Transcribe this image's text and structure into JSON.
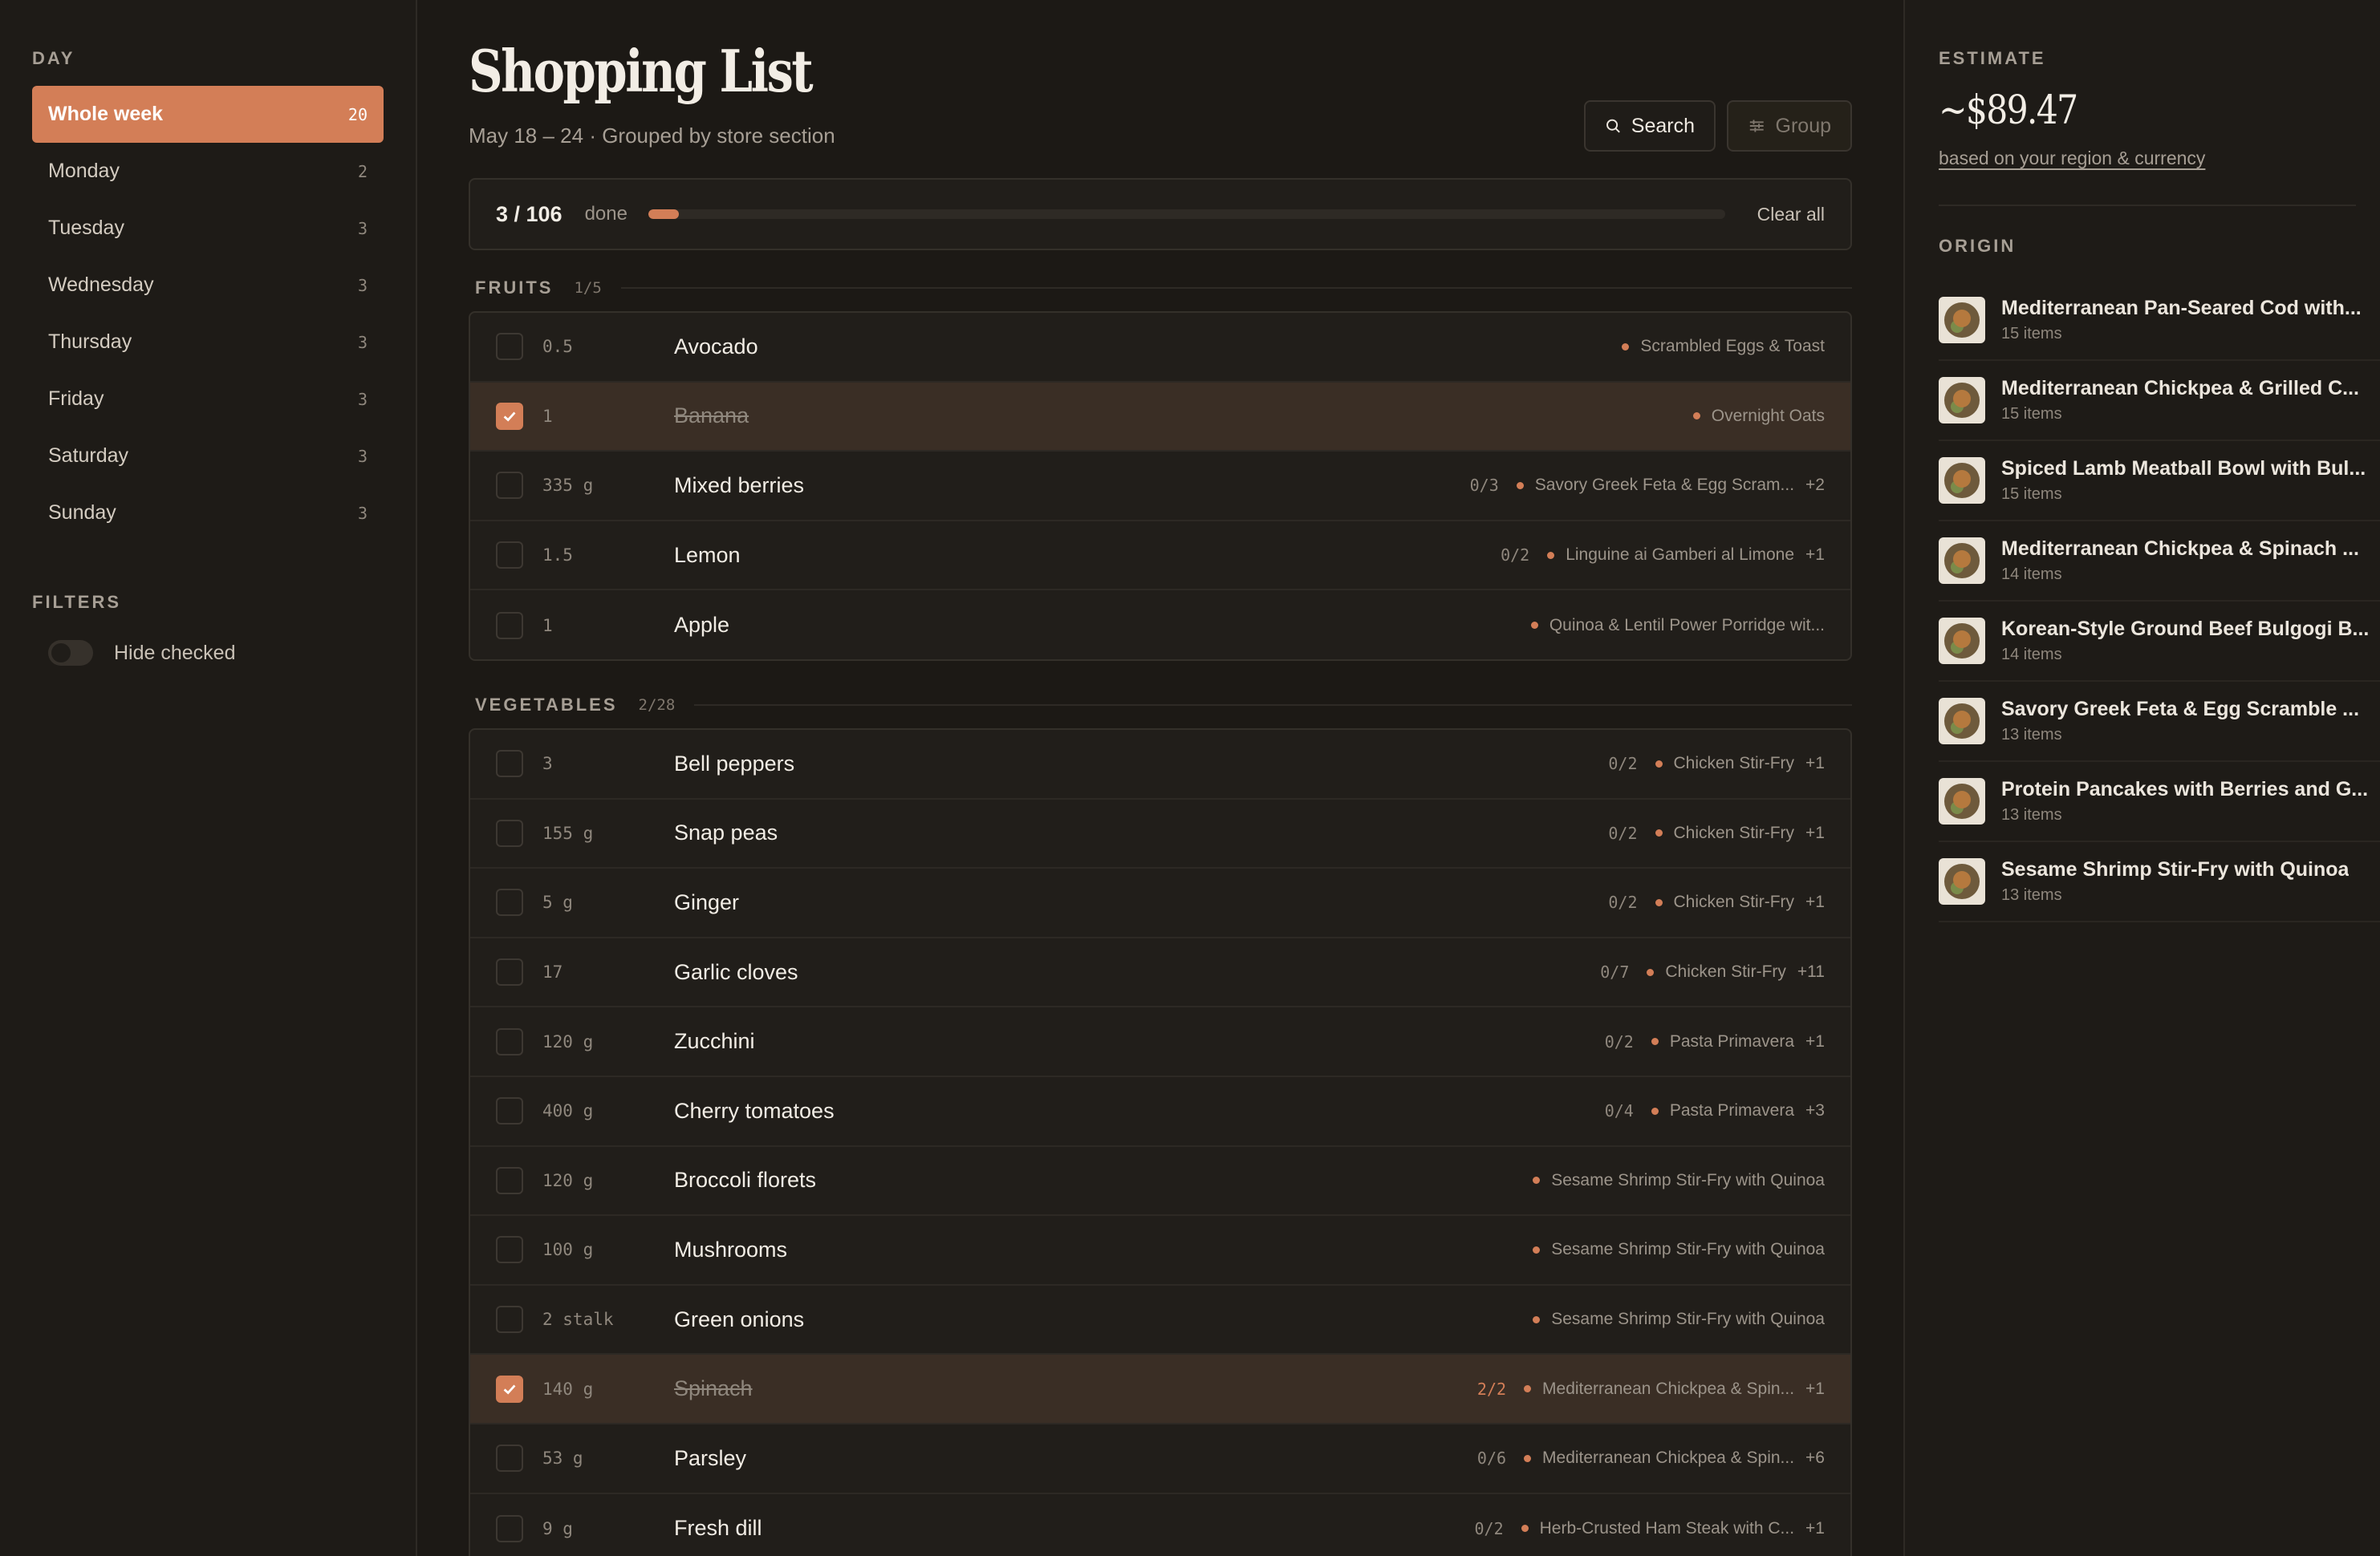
{
  "sidebar": {
    "day_label": "DAY",
    "days": [
      {
        "label": "Whole week",
        "count": "20"
      },
      {
        "label": "Monday",
        "count": "2"
      },
      {
        "label": "Tuesday",
        "count": "3"
      },
      {
        "label": "Wednesday",
        "count": "3"
      },
      {
        "label": "Thursday",
        "count": "3"
      },
      {
        "label": "Friday",
        "count": "3"
      },
      {
        "label": "Saturday",
        "count": "3"
      },
      {
        "label": "Sunday",
        "count": "3"
      }
    ],
    "filters_label": "FILTERS",
    "hide_checked_label": "Hide checked",
    "hide_checked": false
  },
  "header": {
    "title": "Shopping List",
    "subtitle": "May 18 – 24 · Grouped by store section",
    "search_label": "Search",
    "group_label": "Group"
  },
  "progress": {
    "count": "3 / 106",
    "done_label": "done",
    "fraction": 0.028,
    "clear_label": "Clear all"
  },
  "sections": [
    {
      "name": "FRUITS",
      "frac": "1/5",
      "items": [
        {
          "qty": "0.5",
          "name": "Avocado",
          "ratio": "",
          "recipe": "Scrambled Eggs & Toast",
          "extra": "",
          "checked": false
        },
        {
          "qty": "1",
          "name": "Banana",
          "ratio": "",
          "recipe": "Overnight Oats",
          "extra": "",
          "checked": true
        },
        {
          "qty": "335 g",
          "name": "Mixed berries",
          "ratio": "0/3",
          "recipe": "Savory Greek Feta & Egg Scram...",
          "extra": "+2",
          "checked": false
        },
        {
          "qty": "1.5",
          "name": "Lemon",
          "ratio": "0/2",
          "recipe": "Linguine ai Gamberi al Limone",
          "extra": "+1",
          "checked": false
        },
        {
          "qty": "1",
          "name": "Apple",
          "ratio": "",
          "recipe": "Quinoa & Lentil Power Porridge wit...",
          "extra": "",
          "checked": false
        }
      ]
    },
    {
      "name": "VEGETABLES",
      "frac": "2/28",
      "items": [
        {
          "qty": "3",
          "name": "Bell peppers",
          "ratio": "0/2",
          "recipe": "Chicken Stir-Fry",
          "extra": "+1",
          "checked": false
        },
        {
          "qty": "155 g",
          "name": "Snap peas",
          "ratio": "0/2",
          "recipe": "Chicken Stir-Fry",
          "extra": "+1",
          "checked": false
        },
        {
          "qty": "5 g",
          "name": "Ginger",
          "ratio": "0/2",
          "recipe": "Chicken Stir-Fry",
          "extra": "+1",
          "checked": false
        },
        {
          "qty": "17",
          "name": "Garlic cloves",
          "ratio": "0/7",
          "recipe": "Chicken Stir-Fry",
          "extra": "+11",
          "checked": false
        },
        {
          "qty": "120 g",
          "name": "Zucchini",
          "ratio": "0/2",
          "recipe": "Pasta Primavera",
          "extra": "+1",
          "checked": false
        },
        {
          "qty": "400 g",
          "name": "Cherry tomatoes",
          "ratio": "0/4",
          "recipe": "Pasta Primavera",
          "extra": "+3",
          "checked": false
        },
        {
          "qty": "120 g",
          "name": "Broccoli florets",
          "ratio": "",
          "recipe": "Sesame Shrimp Stir-Fry with Quinoa",
          "extra": "",
          "checked": false
        },
        {
          "qty": "100 g",
          "name": "Mushrooms",
          "ratio": "",
          "recipe": "Sesame Shrimp Stir-Fry with Quinoa",
          "extra": "",
          "checked": false
        },
        {
          "qty": "2 stalk",
          "name": "Green onions",
          "ratio": "",
          "recipe": "Sesame Shrimp Stir-Fry with Quinoa",
          "extra": "",
          "checked": false
        },
        {
          "qty": "140 g",
          "name": "Spinach",
          "ratio": "2/2",
          "recipe": "Mediterranean Chickpea & Spin...",
          "extra": "+1",
          "checked": true
        },
        {
          "qty": "53 g",
          "name": "Parsley",
          "ratio": "0/6",
          "recipe": "Mediterranean Chickpea & Spin...",
          "extra": "+6",
          "checked": false
        },
        {
          "qty": "9 g",
          "name": "Fresh dill",
          "ratio": "0/2",
          "recipe": "Herb-Crusted Ham Steak with C...",
          "extra": "+1",
          "checked": false
        }
      ]
    }
  ],
  "estimate": {
    "label": "ESTIMATE",
    "value": "~$89.47",
    "note": "based on your region & currency"
  },
  "origin": {
    "label": "ORIGIN",
    "recipes": [
      {
        "title": "Mediterranean Pan-Seared Cod with...",
        "items": "15 items"
      },
      {
        "title": "Mediterranean Chickpea & Grilled C...",
        "items": "15 items"
      },
      {
        "title": "Spiced Lamb Meatball Bowl with Bul...",
        "items": "15 items"
      },
      {
        "title": "Mediterranean Chickpea & Spinach ...",
        "items": "14 items"
      },
      {
        "title": "Korean-Style Ground Beef Bulgogi B...",
        "items": "14 items"
      },
      {
        "title": "Savory Greek Feta & Egg Scramble ...",
        "items": "13 items"
      },
      {
        "title": "Protein Pancakes with Berries and G...",
        "items": "13 items"
      },
      {
        "title": "Sesame Shrimp Stir-Fry with Quinoa",
        "items": "13 items"
      }
    ]
  },
  "colors": {
    "accent": "#d37e57",
    "bg": "#1c1915",
    "panel": "#1e1b17",
    "card": "#211e1a"
  }
}
